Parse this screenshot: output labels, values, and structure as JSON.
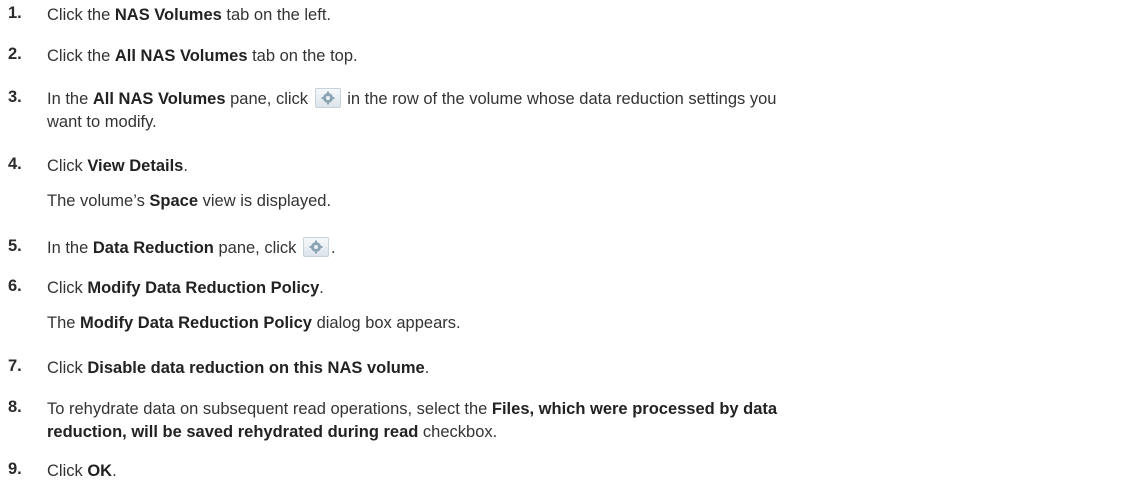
{
  "steps": [
    {
      "num": "1.",
      "pre": "Click the ",
      "b1": "NAS Volumes",
      "post": " tab on the left."
    },
    {
      "num": "2.",
      "pre": "Click the ",
      "b1": "All NAS Volumes",
      "post": " tab on the top."
    },
    {
      "num": "3.",
      "pre": "In the ",
      "b1": "All NAS Volumes",
      "mid": " pane, click ",
      "post": " in the row of the volume whose data reduction settings you",
      "line2": "want to modify."
    },
    {
      "num": "4.",
      "pre": "Click ",
      "b1": "View Details",
      "post": ".",
      "sub_pre": "The volume’s ",
      "sub_b": "Space",
      "sub_post": " view is displayed."
    },
    {
      "num": "5.",
      "pre": "In the ",
      "b1": "Data Reduction",
      "mid": " pane, click ",
      "post": "."
    },
    {
      "num": "6.",
      "pre": "Click ",
      "b1": "Modify Data Reduction Policy",
      "post": ".",
      "sub_pre": "The ",
      "sub_b": "Modify Data Reduction Policy",
      "sub_post": " dialog box appears."
    },
    {
      "num": "7.",
      "pre": "Click ",
      "b1": "Disable data reduction on this NAS volume",
      "post": "."
    },
    {
      "num": "8.",
      "pre": "To rehydrate data on subsequent read operations, select the ",
      "b1": "Files, which were processed by data",
      "b2": "reduction, will be saved rehydrated during read",
      "post": " checkbox."
    },
    {
      "num": "9.",
      "pre": "Click ",
      "b1": "OK",
      "post": "."
    }
  ],
  "icons": {
    "settings": "gear-icon"
  }
}
